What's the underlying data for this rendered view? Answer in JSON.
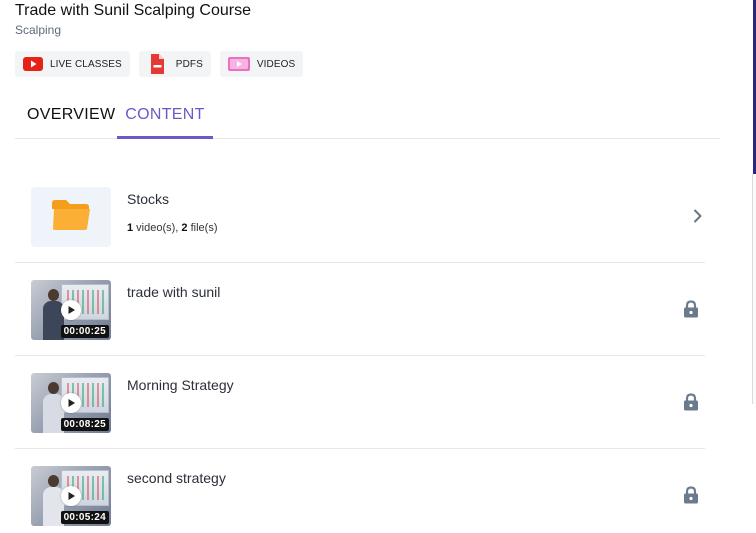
{
  "course": {
    "title": "Trade with Sunil Scalping Course",
    "category": "Scalping"
  },
  "chips": [
    {
      "label": "LIVE CLASSES",
      "icon": "youtube-icon"
    },
    {
      "label": "PDFS",
      "icon": "pdf-file-icon"
    },
    {
      "label": "VIDEOS",
      "icon": "video-player-icon"
    }
  ],
  "tabs": {
    "overview": "OVERVIEW",
    "content": "CONTENT",
    "active": "content"
  },
  "content": {
    "folder": {
      "name": "Stocks",
      "video_count": "1",
      "video_suffix": " video(s), ",
      "file_count": "2",
      "file_suffix": " file(s)"
    },
    "videos": [
      {
        "title": "trade with sunil",
        "duration": "00:00:25",
        "locked": true
      },
      {
        "title": "Morning Strategy",
        "duration": "00:08:25",
        "locked": true
      },
      {
        "title": "second strategy",
        "duration": "00:05:24",
        "locked": true
      }
    ]
  },
  "colors": {
    "accent": "#6a5ac7",
    "folder": "#f9a825",
    "lock": "#6c7a8d"
  }
}
